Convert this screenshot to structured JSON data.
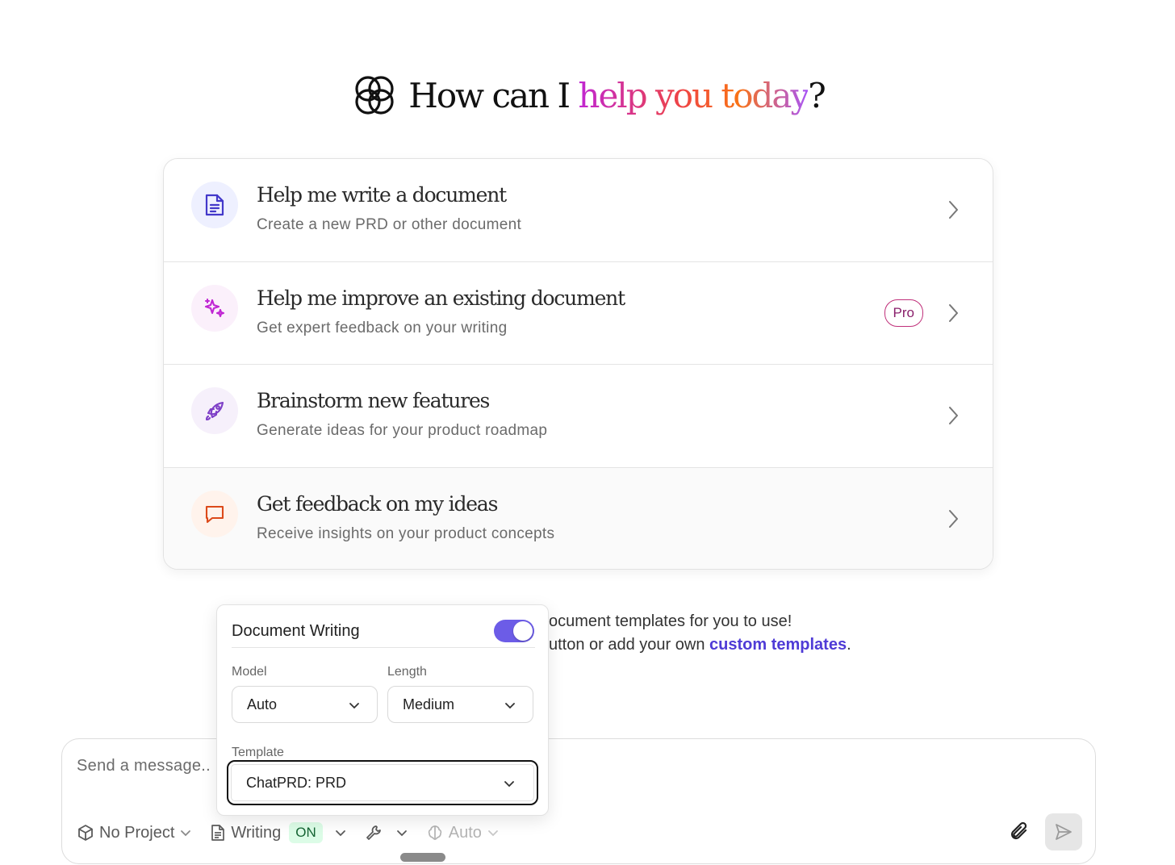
{
  "hero": {
    "title_prefix": "How can I ",
    "title_highlight": "help you today",
    "title_suffix": "?",
    "logo_icon": "interlocking-loops-logo"
  },
  "cards": [
    {
      "title": "Help me write a document",
      "subtitle": "Create a new PRD or other document",
      "icon": "document-icon",
      "icon_color": "#4338ca",
      "icon_bg": "#eef0ff"
    },
    {
      "title": "Help me improve an existing document",
      "subtitle": "Get expert feedback on your writing",
      "icon": "sparkles-icon",
      "icon_color": "#c026d3",
      "icon_bg": "#fbf0fb",
      "badge": "Pro"
    },
    {
      "title": "Brainstorm new features",
      "subtitle": "Generate ideas for your product roadmap",
      "icon": "rocket-icon",
      "icon_color": "#7e3fc7",
      "icon_bg": "#f6f0fb"
    },
    {
      "title": "Get feedback on my ideas",
      "subtitle": "Receive insights on your product concepts",
      "icon": "chat-bubble-icon",
      "icon_color": "#dc4a1a",
      "icon_bg": "#fff3ec"
    }
  ],
  "behind_text": {
    "line1": "ocument templates for you to use!",
    "line2_prefix": "utton or add your own ",
    "line2_link": "custom templates",
    "line2_suffix": "."
  },
  "popup": {
    "title": "Document Writing",
    "toggle_on": true,
    "model_label": "Model",
    "model_value": "Auto",
    "length_label": "Length",
    "length_value": "Medium",
    "template_label": "Template",
    "template_value": "ChatPRD: PRD"
  },
  "composer": {
    "placeholder": "Send a message..",
    "project_label": "No Project",
    "writing_label": "Writing",
    "writing_status": "ON",
    "model_label": "Auto"
  },
  "colors": {
    "accent": "#6c5ce7",
    "link": "#4f3bd6",
    "on_badge_bg": "#dcfce7"
  }
}
